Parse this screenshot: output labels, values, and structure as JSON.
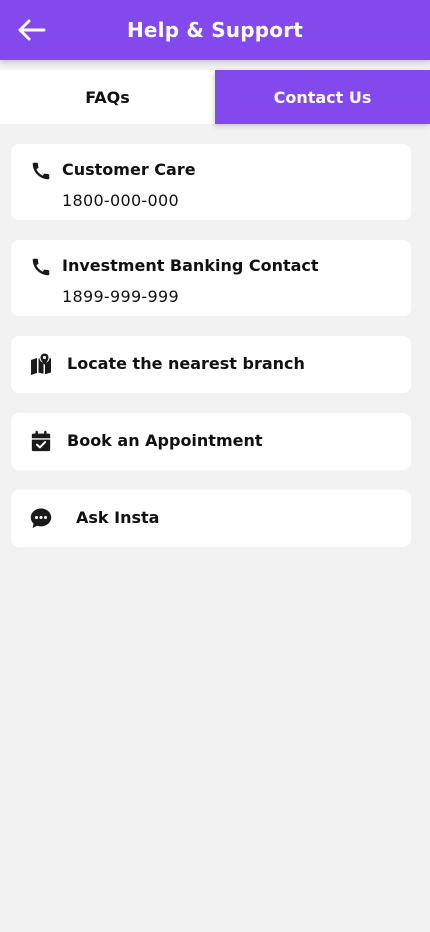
{
  "header": {
    "title": "Help & Support",
    "back_icon": "arrow-left-icon",
    "background": "#8349ec"
  },
  "tabs": [
    {
      "label": "FAQs",
      "active": false
    },
    {
      "label": "Contact Us",
      "active": true
    }
  ],
  "contacts": [
    {
      "icon": "phone-icon",
      "title": "Customer Care",
      "number": "1800-000-000"
    },
    {
      "icon": "phone-icon",
      "title": "Investment Banking Contact",
      "number": "1899-999-999"
    }
  ],
  "actions": [
    {
      "icon": "map-marker-icon",
      "label": "Locate the nearest branch"
    },
    {
      "icon": "calendar-check-icon",
      "label": "Book an Appointment"
    },
    {
      "icon": "chat-bubble-icon",
      "label": "Ask Insta"
    }
  ],
  "colors": {
    "accent": "#8349ec",
    "background": "#f2f2f2",
    "card": "#ffffff",
    "text": "#111111"
  }
}
